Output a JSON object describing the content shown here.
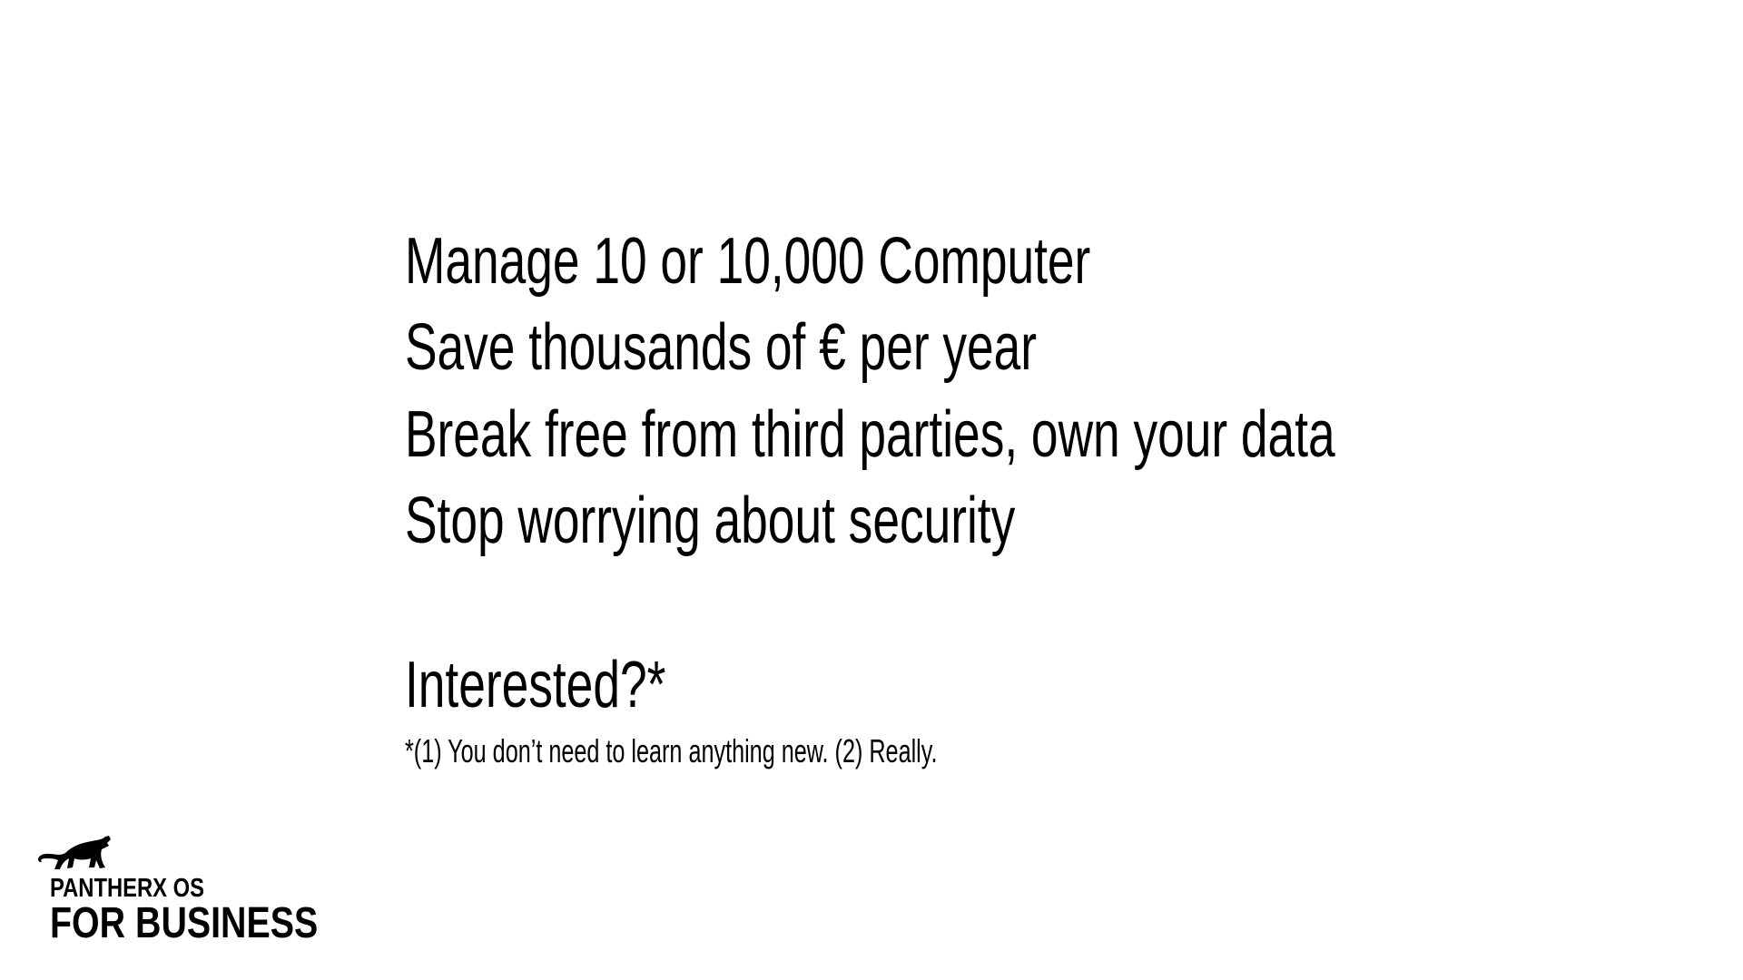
{
  "slide": {
    "bullets": [
      "Manage 10 or 10,000 Computer",
      "Save thousands of € per year",
      "Break free from third parties, own your data",
      "Stop worrying about security"
    ],
    "call_to_action": "Interested?*",
    "footnote": "*(1) You don’t need to learn anything new. (2) Really."
  },
  "logo": {
    "icon": "panther-icon",
    "line1": "PANTHERX OS",
    "line2": "FOR BUSINESS"
  }
}
